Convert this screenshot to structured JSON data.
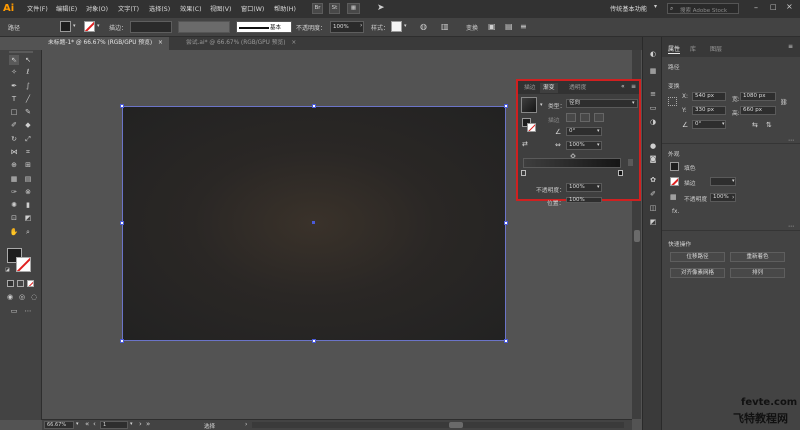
{
  "app": {
    "logo": "Ai"
  },
  "menubar": {
    "items": [
      "文件(F)",
      "编辑(E)",
      "对象(O)",
      "文字(T)",
      "选择(S)",
      "效果(C)",
      "视图(V)",
      "窗口(W)",
      "帮助(H)"
    ],
    "btn_br": "Br",
    "btn_st": "St",
    "workspace": "传统基本功能",
    "search_placeholder": "搜索 Adobe Stock"
  },
  "controlbar": {
    "path_label": "路径",
    "stroke_label": "描边：",
    "stroke_value": "",
    "brush_label": "基本",
    "opacity_label": "不透明度：",
    "opacity_value": "100%",
    "style_label": "样式：",
    "transform_label": "变换"
  },
  "tabs": [
    {
      "label": "未标题-1* @ 66.67% (RGB/GPU 预览)",
      "close": "×"
    },
    {
      "label": "尝试.ai* @ 66.67% (RGB/GPU 预览)",
      "close": "×"
    }
  ],
  "statusbar": {
    "zoom": "66.67%",
    "artboard": "1",
    "mode": "选择"
  },
  "gradient_panel": {
    "tabs": [
      "描边",
      "渐变",
      "透明度"
    ],
    "type_label": "类型：",
    "type_value": "径向",
    "stroke_label": "描边",
    "angle_value": "0°",
    "aspect_value": "100%",
    "opacity_label": "不透明度：",
    "opacity_value": "100%",
    "position_label": "位置：",
    "position_value": "100%",
    "gradient_start_color": "#3e3e3e",
    "gradient_end_color": "#151515"
  },
  "properties_panel": {
    "tabs": [
      "属性",
      "库",
      "图层"
    ],
    "section_path": "路径",
    "transform_label": "变换",
    "x_label": "X:",
    "x_value": "540 px",
    "y_label": "Y:",
    "y_value": "330 px",
    "w_label": "宽:",
    "w_value": "1080 px",
    "h_label": "高:",
    "h_value": "660 px",
    "rotate_value": "0°",
    "appearance_label": "外观",
    "fill_label": "填色",
    "stroke_label": "描边",
    "opacity_label": "不透明度",
    "opacity_value": "100%",
    "fx_label": "fx.",
    "quick_actions_label": "快速操作",
    "btn_offset_path": "位移路径",
    "btn_recolor": "重新着色",
    "btn_align_pixel": "对齐像素网格",
    "btn_arrange": "排列"
  },
  "watermark": {
    "site": "fevte.com",
    "name": "飞特教程网"
  },
  "colors": {
    "artboard_border": "#6b74c8",
    "panel_highlight": "#d02020",
    "ai_orange": "#ff9a00"
  }
}
